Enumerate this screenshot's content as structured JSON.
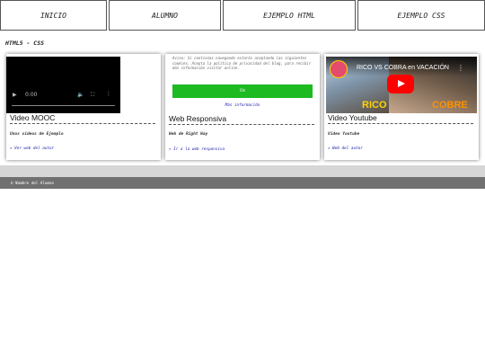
{
  "nav": {
    "items": [
      {
        "label": "INICIO"
      },
      {
        "label": "ALUMNO"
      },
      {
        "label": "EJEMPLO HTML"
      },
      {
        "label": "EJEMPLO CSS"
      }
    ]
  },
  "page": {
    "title": "HTML5 - CSS"
  },
  "cards": [
    {
      "title": "Video MOOC",
      "description": "Unos videos de Ejemplo",
      "link": "» Ver web del autor",
      "video_time": "0:00"
    },
    {
      "title": "Web Responsiva",
      "description": "Web de Right Way",
      "link": "» Ir a la web responsiva"
    },
    {
      "title": "Video Youtube",
      "description": "Video Youtube",
      "link": "» Web del autor"
    }
  ],
  "consent": {
    "text": "Aviso: Si continúas navegando estarás aceptando las siguientes cookies. Acepta la política de privacidad del blog, para recibir más información visitar online.",
    "accept": "Ok",
    "more": "Más información"
  },
  "youtube": {
    "title": "RICO VS COBRA en VACACIÓN",
    "overlay_left": "RICO",
    "overlay_right": "COBRE"
  },
  "footer": {
    "text": "© Nombre del Alumno"
  }
}
